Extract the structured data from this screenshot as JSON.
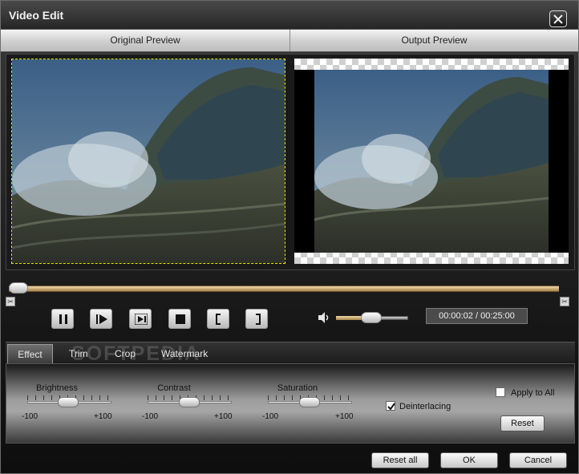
{
  "window": {
    "title": "Video Edit"
  },
  "preview": {
    "original_label": "Original Preview",
    "output_label": "Output Preview"
  },
  "playback": {
    "time": "00:00:02 / 00:25:00",
    "timeline_position": 0.0,
    "volume_level": 0.45
  },
  "tabs": [
    {
      "label": "Effect",
      "active": true
    },
    {
      "label": "Trim"
    },
    {
      "label": "Crop"
    },
    {
      "label": "Watermark"
    }
  ],
  "watermark_overlay": "SOFTPEDIA",
  "effect": {
    "sliders": [
      {
        "label": "Brightness",
        "min": "-100",
        "max": "+100",
        "value": 0
      },
      {
        "label": "Contrast",
        "min": "-100",
        "max": "+100",
        "value": 0
      },
      {
        "label": "Saturation",
        "min": "-100",
        "max": "+100",
        "value": 0
      }
    ],
    "deinterlacing": {
      "label": "Deinterlacing",
      "checked": true
    },
    "apply_to_all": {
      "label": "Apply to All",
      "checked": false
    },
    "reset_label": "Reset"
  },
  "footer": {
    "reset_all_label": "Reset all",
    "ok_label": "OK",
    "cancel_label": "Cancel"
  },
  "icons": [
    "close-icon",
    "pause-icon",
    "play-icon",
    "next-frame-icon",
    "stop-icon",
    "mark-in-icon",
    "mark-out-icon",
    "volume-icon",
    "scissors-icon"
  ]
}
